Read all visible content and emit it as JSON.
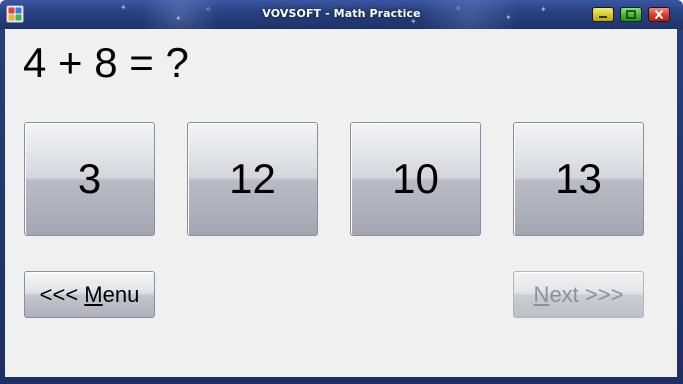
{
  "window": {
    "title": "VOVSOFT - Math Practice",
    "app_icon": "calculator-app-icon",
    "controls": {
      "minimize_icon": "minimize-icon",
      "maximize_icon": "maximize-icon",
      "close_icon": "close-icon"
    }
  },
  "question": {
    "text": "4 + 8 = ?"
  },
  "answers": [
    {
      "label": "3"
    },
    {
      "label": "12"
    },
    {
      "label": "10"
    },
    {
      "label": "13"
    }
  ],
  "nav": {
    "menu": {
      "prefix": "<<< ",
      "hotkey": "M",
      "rest": "enu",
      "enabled": true
    },
    "next": {
      "hotkey": "N",
      "rest": "ext >>>",
      "enabled": false
    }
  },
  "colors": {
    "titlebar": "#27407f",
    "client_background": "#f0f0f0",
    "minimize_button": "#d4c823",
    "maximize_button": "#43b336",
    "close_button": "#d43b28",
    "disabled_text": "#8d9099"
  }
}
